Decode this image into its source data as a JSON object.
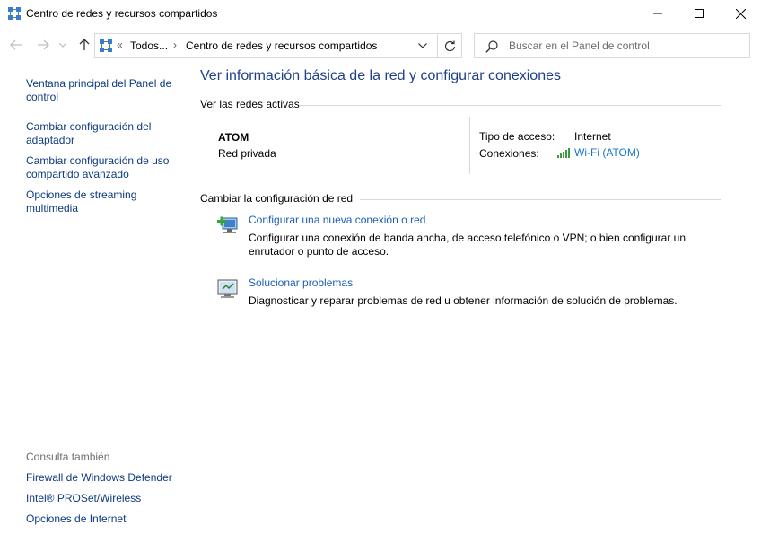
{
  "window": {
    "title": "Centro de redes y recursos compartidos"
  },
  "navigation": {
    "breadcrumb_prefix": "«",
    "breadcrumb_root": "Todos...",
    "breadcrumb_separator": "›",
    "breadcrumb_current": "Centro de redes y recursos compartidos",
    "search_placeholder": "Buscar en el Panel de control"
  },
  "sidebar": {
    "links": [
      {
        "label": "Ventana principal del Panel de control"
      },
      {
        "label": "Cambiar configuración del adaptador"
      },
      {
        "label": "Cambiar configuración de uso compartido avanzado"
      },
      {
        "label": "Opciones de streaming multimedia"
      }
    ],
    "see_also_label": "Consulta también",
    "see_also_links": [
      {
        "label": "Firewall de Windows Defender"
      },
      {
        "label": "Intel® PROSet/Wireless"
      },
      {
        "label": "Opciones de Internet"
      }
    ]
  },
  "main": {
    "heading": "Ver información básica de la red y configurar conexiones",
    "active_networks_label": "Ver las redes activas",
    "network": {
      "name": "ATOM",
      "type": "Red privada",
      "access_type_label": "Tipo de acceso:",
      "access_type_value": "Internet",
      "connections_label": "Conexiones:",
      "connection_link": "Wi-Fi (ATOM)"
    },
    "change_settings_label": "Cambiar la configuración de red",
    "tasks": [
      {
        "title": "Configurar una nueva conexión o red",
        "description": "Configurar una conexión de banda ancha, de acceso telefónico o VPN; o bien configurar un enrutador o punto de acceso."
      },
      {
        "title": "Solucionar problemas",
        "description": "Diagnosticar y reparar problemas de red u obtener información de solución de problemas."
      }
    ]
  },
  "colors": {
    "heading": "#1e3f8a",
    "link": "#1a5fb4",
    "nav_link": "#0d3a80",
    "muted": "#6d6d6d",
    "divider": "#d9d9d9"
  },
  "icons": {
    "app": "network-center-icon",
    "back": "arrow-left-icon",
    "forward": "arrow-right-icon",
    "recent": "chevron-down-icon",
    "up": "arrow-up-icon",
    "address_dropdown": "chevron-down-icon",
    "refresh": "refresh-icon",
    "search": "search-icon",
    "wifi": "wifi-signal-icon",
    "new_connection": "new-connection-icon",
    "troubleshoot": "troubleshoot-icon"
  }
}
